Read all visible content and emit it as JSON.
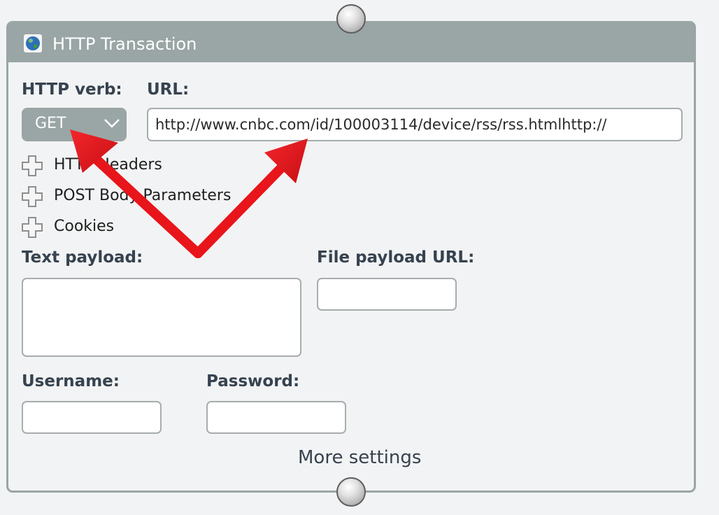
{
  "panel": {
    "title": "HTTP Transaction",
    "icon": "globe-icon"
  },
  "http_verb": {
    "label": "HTTP verb:",
    "selected": "GET"
  },
  "url": {
    "label": "URL:",
    "value": "http://www.cnbc.com/id/100003114/device/rss/rss.htmlhttp://"
  },
  "expanders": [
    {
      "label": "HTTP Headers",
      "icon": "plus-expand-icon"
    },
    {
      "label": "POST Body Parameters",
      "icon": "plus-expand-icon"
    },
    {
      "label": "Cookies",
      "icon": "plus-expand-icon"
    }
  ],
  "text_payload": {
    "label": "Text payload:",
    "value": ""
  },
  "file_payload_url": {
    "label": "File payload URL:",
    "value": ""
  },
  "username": {
    "label": "Username:",
    "value": ""
  },
  "password": {
    "label": "Password:",
    "value": ""
  },
  "more_settings": "More settings",
  "colors": {
    "header": "#9aa5a5",
    "label": "#36424f",
    "annotation_arrow": "#e8151b"
  }
}
